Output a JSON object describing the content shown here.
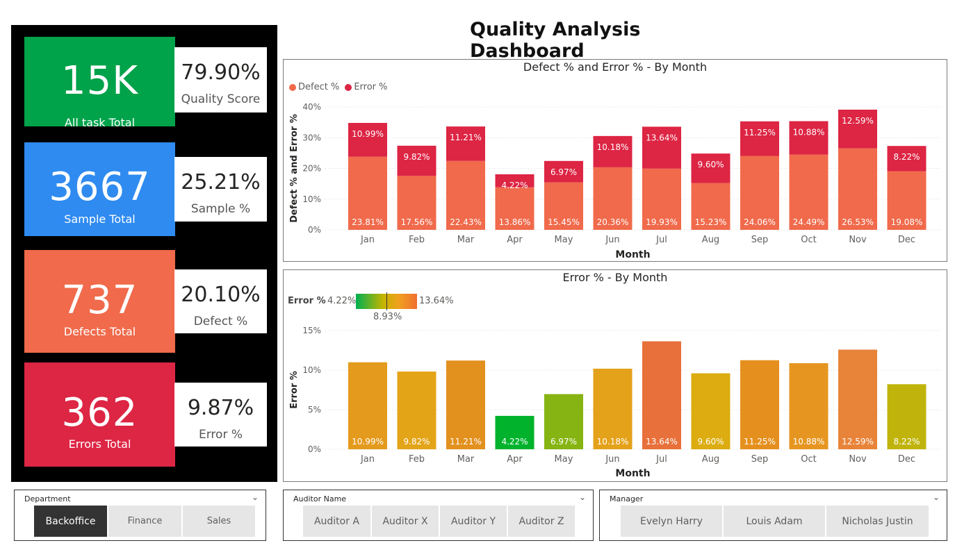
{
  "title": "Quality Analysis Dashboard",
  "colors": {
    "green": "#00a24a",
    "blue": "#2f8bf0",
    "orange": "#f06a4b",
    "red": "#dd2544",
    "defect": "#f06a4b",
    "error": "#dd2544"
  },
  "kpis": [
    {
      "value": "15K",
      "label": "All task Total",
      "color": "#00a24a",
      "pct": "79.90%",
      "pct_label": "Quality Score"
    },
    {
      "value": "3667",
      "label": "Sample Total",
      "color": "#2f8bf0",
      "pct": "25.21%",
      "pct_label": "Sample %"
    },
    {
      "value": "737",
      "label": "Defects Total",
      "color": "#f06a4b",
      "pct": "20.10%",
      "pct_label": "Defect %"
    },
    {
      "value": "362",
      "label": "Errors Total",
      "color": "#dd2544",
      "pct": "9.87%",
      "pct_label": "Error %"
    }
  ],
  "chart_data": [
    {
      "type": "bar",
      "stacked": true,
      "title": "Defect % and Error % - By Month",
      "xlabel": "Month",
      "ylabel": "Defect % and Error %",
      "ylim": [
        0,
        40
      ],
      "yticks": [
        "0%",
        "10%",
        "20%",
        "30%",
        "40%"
      ],
      "grid": true,
      "legend_position": "top-left",
      "categories": [
        "Jan",
        "Feb",
        "Mar",
        "Apr",
        "May",
        "Jun",
        "Jul",
        "Aug",
        "Sep",
        "Oct",
        "Nov",
        "Dec"
      ],
      "series": [
        {
          "name": "Defect %",
          "color": "#f06a4b",
          "values": [
            23.81,
            17.56,
            22.43,
            13.86,
            15.45,
            20.36,
            19.93,
            15.23,
            24.06,
            24.49,
            26.53,
            19.08
          ],
          "labels": [
            "23.81%",
            "17.56%",
            "22.43%",
            "13.86%",
            "15.45%",
            "20.36%",
            "19.93%",
            "15.23%",
            "24.06%",
            "24.49%",
            "26.53%",
            "19.08%"
          ]
        },
        {
          "name": "Error %",
          "color": "#dd2544",
          "values": [
            10.99,
            9.82,
            11.21,
            4.22,
            6.97,
            10.18,
            13.64,
            9.6,
            11.25,
            10.88,
            12.59,
            8.22
          ],
          "labels": [
            "10.99%",
            "9.82%",
            "11.21%",
            "4.22%",
            "6.97%",
            "10.18%",
            "13.64%",
            "9.60%",
            "11.25%",
            "10.88%",
            "12.59%",
            "8.22%"
          ]
        }
      ]
    },
    {
      "type": "bar",
      "title": "Error % - By Month",
      "xlabel": "Month",
      "ylabel": "Error %",
      "ylim": [
        0,
        15
      ],
      "yticks": [
        "0%",
        "5%",
        "10%",
        "15%"
      ],
      "grid": true,
      "legend_position": "top-left",
      "gradient_legend": {
        "name": "Error %",
        "min": "4.22%",
        "mid": "8.93%",
        "max": "13.64%"
      },
      "categories": [
        "Jan",
        "Feb",
        "Mar",
        "Apr",
        "May",
        "Jun",
        "Jul",
        "Aug",
        "Sep",
        "Oct",
        "Nov",
        "Dec"
      ],
      "series": [
        {
          "name": "Error %",
          "values": [
            10.99,
            9.82,
            11.21,
            4.22,
            6.97,
            10.18,
            13.64,
            9.6,
            11.25,
            10.88,
            12.59,
            8.22
          ],
          "labels": [
            "10.99%",
            "9.82%",
            "11.21%",
            "4.22%",
            "6.97%",
            "10.18%",
            "13.64%",
            "9.60%",
            "11.25%",
            "10.88%",
            "12.59%",
            "8.22%"
          ],
          "colors": [
            "#e49a1c",
            "#e4a418",
            "#e2901e",
            "#00b22c",
            "#86b412",
            "#e4a11a",
            "#e8703a",
            "#dcac10",
            "#e5901e",
            "#e69620",
            "#e8843a",
            "#c0b40c"
          ]
        }
      ]
    }
  ],
  "slicers": {
    "department": {
      "header": "Department",
      "options": [
        "Backoffice",
        "Finance",
        "Sales"
      ],
      "selected": "Backoffice"
    },
    "auditor": {
      "header": "Auditor Name",
      "options": [
        "Auditor A",
        "Auditor X",
        "Auditor Y",
        "Auditor Z"
      ]
    },
    "manager": {
      "header": "Manager",
      "options": [
        "Evelyn Harry",
        "Louis Adam",
        "Nicholas Justin"
      ]
    }
  }
}
